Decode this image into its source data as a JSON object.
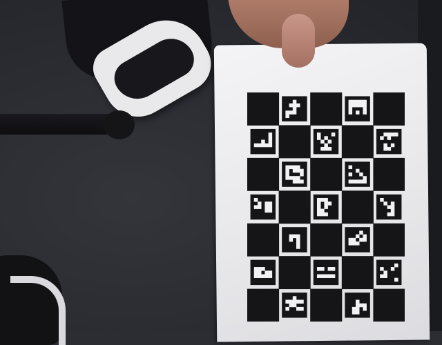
{
  "scene": {
    "subject": "charuco-calibration-board",
    "board": {
      "columns": 5,
      "rows": 7,
      "black_first": true,
      "colors": {
        "black": "#151518",
        "white": "#f2f2f4",
        "paper": "#eeeef0"
      },
      "markers": [
        {
          "cell": [
            1,
            0
          ],
          "pattern": [
            "11011",
            "10001",
            "11011",
            "00011",
            "01111"
          ]
        },
        {
          "cell": [
            3,
            0
          ],
          "pattern": [
            "00000",
            "00000",
            "01110",
            "01010",
            "11111"
          ]
        },
        {
          "cell": [
            0,
            1
          ],
          "pattern": [
            "11110",
            "11110",
            "11010",
            "00000",
            "11111"
          ]
        },
        {
          "cell": [
            2,
            1
          ],
          "pattern": [
            "01110",
            "01011",
            "10101",
            "11011",
            "10001"
          ]
        },
        {
          "cell": [
            4,
            1
          ],
          "pattern": [
            "10000",
            "01011",
            "11111",
            "10101",
            "10011"
          ]
        },
        {
          "cell": [
            1,
            2
          ],
          "pattern": [
            "00001",
            "01000",
            "01110",
            "00001",
            "11000"
          ]
        },
        {
          "cell": [
            3,
            2
          ],
          "pattern": [
            "01111",
            "11011",
            "01101",
            "11110",
            "00000"
          ]
        },
        {
          "cell": [
            0,
            3
          ],
          "pattern": [
            "01111",
            "10100",
            "00100",
            "11100",
            "11111"
          ]
        },
        {
          "cell": [
            2,
            3
          ],
          "pattern": [
            "00011",
            "01001",
            "01011",
            "00111",
            "00011"
          ]
        },
        {
          "cell": [
            4,
            3
          ],
          "pattern": [
            "01111",
            "10101",
            "11001",
            "11101",
            "11001"
          ]
        },
        {
          "cell": [
            1,
            4
          ],
          "pattern": [
            "11111",
            "10001",
            "10101",
            "11101",
            "11101"
          ]
        },
        {
          "cell": [
            3,
            4
          ],
          "pattern": [
            "11101",
            "11010",
            "00100",
            "00011",
            "11111"
          ]
        },
        {
          "cell": [
            0,
            5
          ],
          "pattern": [
            "11111",
            "00011",
            "00100",
            "00000",
            "11111"
          ]
        },
        {
          "cell": [
            2,
            5
          ],
          "pattern": [
            "11111",
            "00100",
            "11111",
            "00000",
            "11111"
          ]
        },
        {
          "cell": [
            4,
            5
          ],
          "pattern": [
            "11110",
            "01101",
            "10111",
            "00111",
            "11110"
          ]
        },
        {
          "cell": [
            1,
            6
          ],
          "pattern": [
            "11011",
            "00000",
            "10011",
            "01100",
            "11111"
          ]
        },
        {
          "cell": [
            3,
            6
          ],
          "pattern": [
            "11111",
            "11011",
            "11000",
            "10010",
            "10011"
          ]
        }
      ]
    }
  }
}
